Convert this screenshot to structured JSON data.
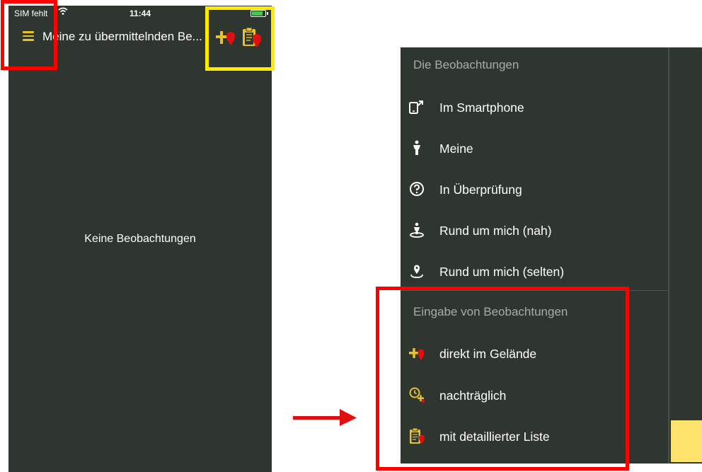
{
  "left_screen": {
    "status_bar": {
      "carrier": "SIM fehlt",
      "time": "11:44"
    },
    "nav_bar": {
      "title": "Meine zu übermittelnden Be..."
    },
    "empty_message": "Keine Beobachtungen"
  },
  "drawer": {
    "section_observations": {
      "header": "Die Beobachtungen",
      "items": [
        {
          "label": "Im Smartphone",
          "icon": "smartphone-icon"
        },
        {
          "label": "Meine",
          "icon": "person-icon"
        },
        {
          "label": "In Überprüfung",
          "icon": "question-circle-icon"
        },
        {
          "label": "Rund um mich (nah)",
          "icon": "person-location-icon"
        },
        {
          "label": "Rund um mich (selten)",
          "icon": "location-pin-icon"
        }
      ]
    },
    "section_entry": {
      "header": "Eingabe von Beobachtungen",
      "items": [
        {
          "label": "direkt im Gelände",
          "icon": "plus-pin-icon"
        },
        {
          "label": "nachträglich",
          "icon": "clock-plus-icon"
        },
        {
          "label": "mit detaillierter Liste",
          "icon": "clipboard-pin-icon"
        }
      ]
    }
  },
  "colors": {
    "background": "#2f362f",
    "accent_yellow": "#e8c22a",
    "accent_red": "#e01010",
    "highlight_red": "#ff0000",
    "highlight_yellow": "#ffea00"
  }
}
